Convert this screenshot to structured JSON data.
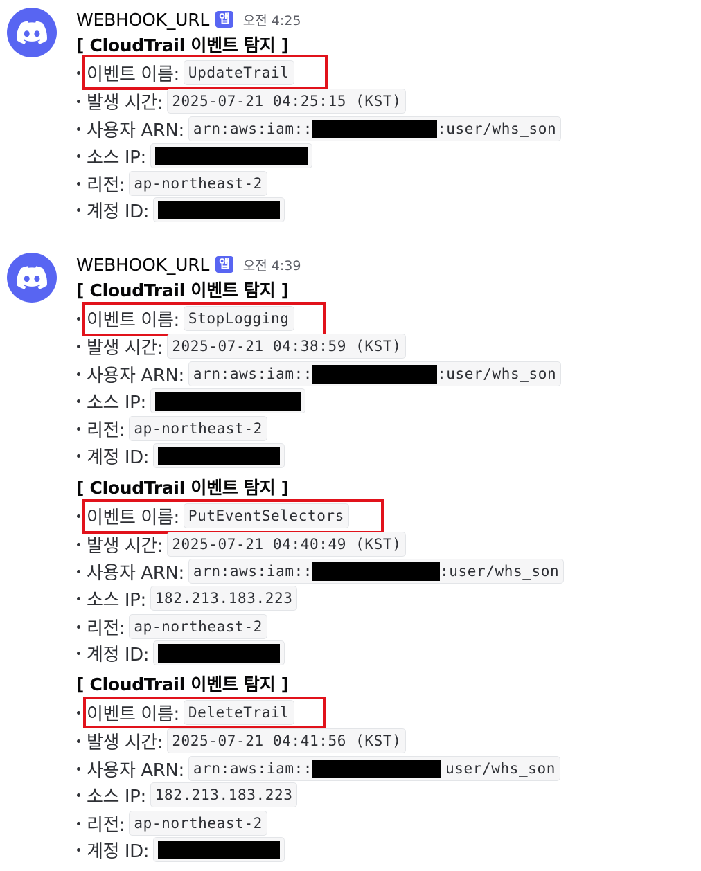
{
  "messages": [
    {
      "username": "WEBHOOK_URL",
      "badge": "앱",
      "time": "오전 4:25",
      "events": [
        {
          "title": "[ CloudTrail 이벤트 탐지 ]",
          "event_label": "이벤트 이름:",
          "event_name": "UpdateTrail",
          "time_label": "발생 시간:",
          "time_value": "2025-07-21 04:25:15 (KST)",
          "arn_label": "사용자 ARN:",
          "arn_prefix": "arn:aws:iam::",
          "arn_suffix": ":user/whs_son",
          "ip_label": "소스 IP:",
          "ip_value": "",
          "region_label": "리전:",
          "region_value": "ap-northeast-2",
          "account_label": "계정 ID:"
        }
      ]
    },
    {
      "username": "WEBHOOK_URL",
      "badge": "앱",
      "time": "오전 4:39",
      "events": [
        {
          "title": "[ CloudTrail 이벤트 탐지 ]",
          "event_label": "이벤트 이름:",
          "event_name": "StopLogging",
          "time_label": "발생 시간:",
          "time_value": "2025-07-21 04:38:59 (KST)",
          "arn_label": "사용자 ARN:",
          "arn_prefix": "arn:aws:iam::",
          "arn_suffix": ":user/whs_son",
          "ip_label": "소스 IP:",
          "ip_value": "",
          "region_label": "리전:",
          "region_value": "ap-northeast-2",
          "account_label": "계정 ID:"
        },
        {
          "title": "[ CloudTrail 이벤트 탐지 ]",
          "event_label": "이벤트 이름:",
          "event_name": "PutEventSelectors",
          "time_label": "발생 시간:",
          "time_value": "2025-07-21 04:40:49 (KST)",
          "arn_label": "사용자 ARN:",
          "arn_prefix": "arn:aws:iam::",
          "arn_suffix": ":user/whs_son",
          "ip_label": "소스 IP:",
          "ip_value": "182.213.183.223",
          "region_label": "리전:",
          "region_value": "ap-northeast-2",
          "account_label": "계정 ID:"
        },
        {
          "title": "[ CloudTrail 이벤트 탐지 ]",
          "event_label": "이벤트 이름:",
          "event_name": "DeleteTrail",
          "time_label": "발생 시간:",
          "time_value": "2025-07-21 04:41:56 (KST)",
          "arn_label": "사용자 ARN:",
          "arn_prefix": "arn:aws:iam::",
          "arn_suffix": "user/whs_son",
          "ip_label": "소스 IP:",
          "ip_value": "182.213.183.223",
          "region_label": "리전:",
          "region_value": "ap-northeast-2",
          "account_label": "계정 ID:"
        }
      ]
    }
  ],
  "colors": {
    "brand": "#5865f2",
    "highlight": "#e1121b",
    "redaction": "#000000"
  },
  "icons": {
    "avatar": "discord-logo-icon"
  }
}
